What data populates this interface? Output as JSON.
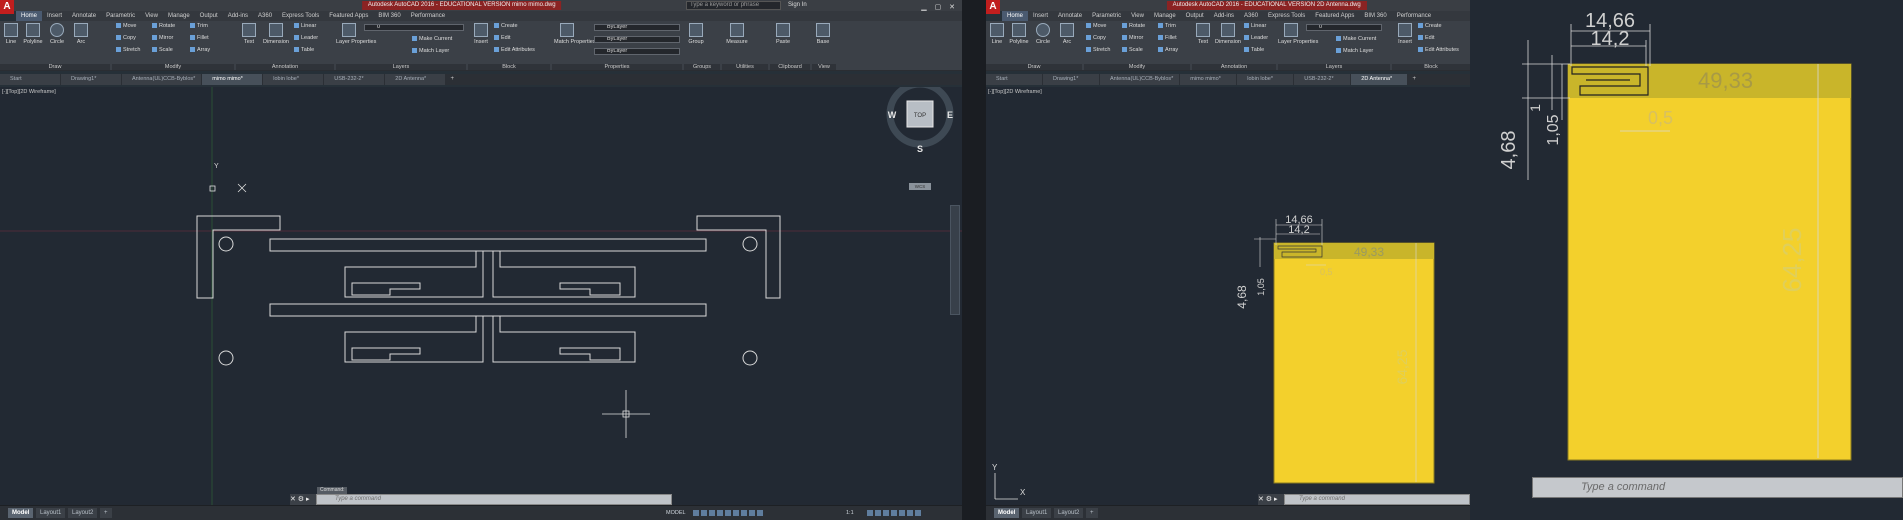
{
  "left": {
    "title": "Autodesk AutoCAD 2016 - EDUCATIONAL VERSION   mimo mimo.dwg",
    "search_placeholder": "Type a keyword or phrase",
    "sign_in": "Sign In",
    "menu": [
      "Home",
      "Insert",
      "Annotate",
      "Parametric",
      "View",
      "Manage",
      "Output",
      "Add-ins",
      "A360",
      "Express Tools",
      "Featured Apps",
      "BIM 360",
      "Performance"
    ],
    "draw": {
      "line": "Line",
      "polyline": "Polyline",
      "circle": "Circle",
      "arc": "Arc"
    },
    "modify": {
      "move": "Move",
      "rotate": "Rotate",
      "trim": "Trim",
      "copy": "Copy",
      "mirror": "Mirror",
      "fillet": "Fillet",
      "stretch": "Stretch",
      "scale": "Scale",
      "array": "Array"
    },
    "annotation": {
      "text": "Text",
      "dimension": "Dimension",
      "linear": "Linear",
      "leader": "Leader",
      "table": "Table"
    },
    "layers": {
      "layer_properties": "Layer Properties",
      "make_current": "Make Current",
      "match_layer": "Match Layer",
      "layer_value": "0"
    },
    "block": {
      "insert": "Insert",
      "create": "Create",
      "edit": "Edit",
      "edit_attributes": "Edit Attributes"
    },
    "properties": {
      "match_properties": "Match Properties",
      "bylayer1": "ByLayer",
      "bylayer2": "ByLayer",
      "bylayer3": "ByLayer"
    },
    "groups": {
      "group": "Group"
    },
    "utilities": {
      "measure": "Measure"
    },
    "clipboard": {
      "paste": "Paste"
    },
    "view": {
      "base": "Base"
    },
    "panels": [
      "Draw",
      "Modify",
      "Annotation",
      "Layers",
      "Block",
      "Properties",
      "Groups",
      "Utilities",
      "Clipboard",
      "View"
    ],
    "tabs": [
      "Start",
      "Drawing1*",
      "Antenna(UL)CCB-Byblos*",
      "mimo mimo*",
      "lobin lobe*",
      "USB-232-2*",
      "2D Antenna*"
    ],
    "active_tab": 3,
    "viewport_label": "[-][Top][2D Wireframe]",
    "viewcube": {
      "n": "N",
      "s": "S",
      "e": "E",
      "w": "W",
      "top": "TOP",
      "wcs": "WCS"
    },
    "axis_y": "Y",
    "command_placeholder": "Type a command",
    "command_tag": "Command:",
    "layout_tabs": [
      "Model",
      "Layout1",
      "Layout2"
    ],
    "status_model": "MODEL",
    "status_scale": "1:1"
  },
  "middle": {
    "title": "Autodesk AutoCAD 2016 - EDUCATIONAL VERSION   2D Antenna.dwg",
    "menu": [
      "Home",
      "Insert",
      "Annotate",
      "Parametric",
      "View",
      "Manage",
      "Output",
      "Add-ins",
      "A360",
      "Express Tools",
      "Featured Apps",
      "BIM 360",
      "Performance"
    ],
    "tabs": [
      "Start",
      "Drawing1*",
      "Antenna(UL)CCB-Byblos*",
      "mimo mimo*",
      "lobin lobe*",
      "USB-232-2*",
      "2D Antenna*"
    ],
    "active_tab": 6,
    "viewport_label": "[-][Top][2D Wireframe]",
    "dims": {
      "d1": "14,66",
      "d2": "14,2",
      "d3": "49,33",
      "d4": "4,68",
      "d5": "1,05",
      "d6": "0,5",
      "d7": "64,25"
    },
    "axis_x": "X",
    "axis_y": "Y",
    "command_placeholder": "Type a command",
    "layout_tabs": [
      "Model",
      "Layout1",
      "Layout2"
    ]
  },
  "right": {
    "dims": {
      "d1": "14,66",
      "d2": "14,2",
      "d3": "49,33",
      "d4": "4,68",
      "d5": "1,05",
      "d6": "0,5",
      "d7": "64,25",
      "d8": "1"
    },
    "command_placeholder": "Type a command"
  },
  "colors": {
    "board": "#f3d02c",
    "drawing_line": "#d9d9d9",
    "canvas": "#222933"
  }
}
